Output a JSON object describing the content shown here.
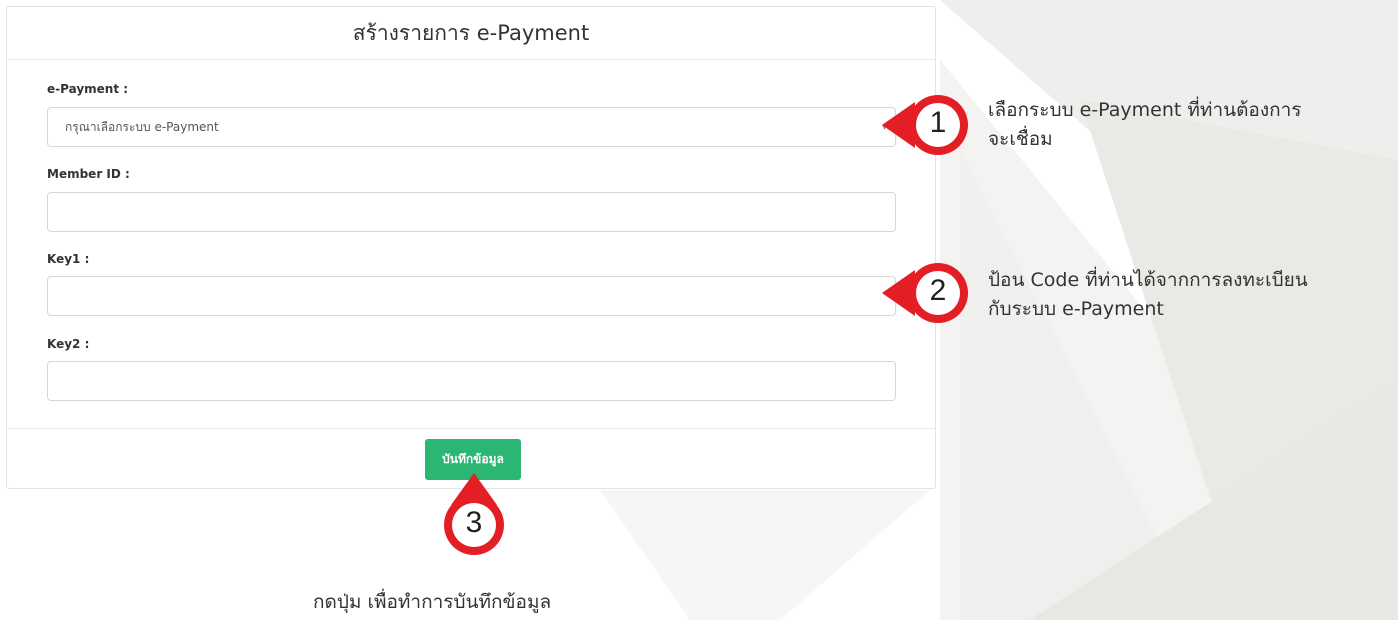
{
  "form": {
    "title": "สร้างรายการ e-Payment",
    "epayment_label": "e-Payment :",
    "epayment_placeholder": "กรุณาเลือกระบบ e-Payment",
    "member_label": "Member ID :",
    "key1_label": "Key1 :",
    "key2_label": "Key2 :",
    "save_label": "บันทึกข้อมูล"
  },
  "callouts": {
    "step1": "1",
    "step1_line1": "เลือกระบบ e-Payment ที่ท่านต้องการ",
    "step1_line2": "จะเชื่อม",
    "step2": "2",
    "step2_line1": "ป้อน Code ที่ท่านได้จากการลงทะเบียน",
    "step2_line2": "กับระบบ e-Payment",
    "step3": "3",
    "step3_text": "กดปุ่ม เพื่อทำการบันทึกข้อมูล"
  },
  "colors": {
    "accent_red": "#e31e24",
    "button_green": "#2bb673"
  }
}
